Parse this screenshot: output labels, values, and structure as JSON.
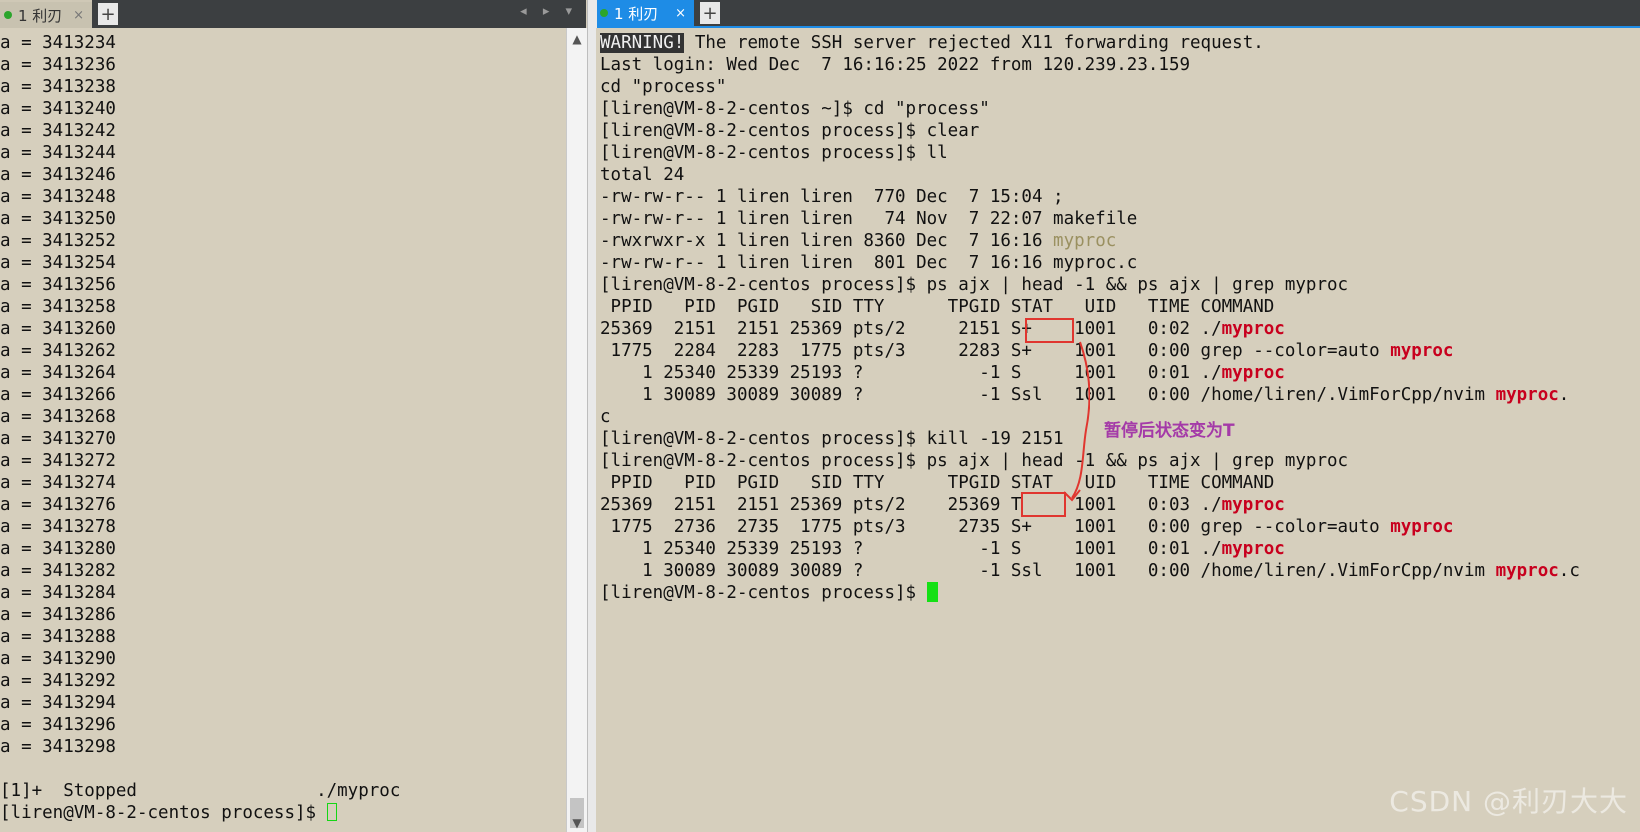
{
  "left_tab": {
    "label": "1 利刃",
    "close": "×",
    "add": "+",
    "nav": "◂ ▸ ▾"
  },
  "right_tab": {
    "label": "1 利刃",
    "close": "×",
    "add": "+"
  },
  "left_terminal": {
    "lines": [
      "a = 3413234",
      "a = 3413236",
      "a = 3413238",
      "a = 3413240",
      "a = 3413242",
      "a = 3413244",
      "a = 3413246",
      "a = 3413248",
      "a = 3413250",
      "a = 3413252",
      "a = 3413254",
      "a = 3413256",
      "a = 3413258",
      "a = 3413260",
      "a = 3413262",
      "a = 3413264",
      "a = 3413266",
      "a = 3413268",
      "a = 3413270",
      "a = 3413272",
      "a = 3413274",
      "a = 3413276",
      "a = 3413278",
      "a = 3413280",
      "a = 3413282",
      "a = 3413284",
      "a = 3413286",
      "a = 3413288",
      "a = 3413290",
      "a = 3413292",
      "a = 3413294",
      "a = 3413296",
      "a = 3413298"
    ],
    "stopped": "[1]+  Stopped                 ./myproc",
    "prompt": "[liren@VM-8-2-centos process]$ "
  },
  "right_terminal": {
    "warning_label": "WARNING!",
    "warning_text": " The remote SSH server rejected X11 forwarding request.",
    "lines_a": [
      "Last login: Wed Dec  7 16:16:25 2022 from 120.239.23.159",
      "cd \"process\"",
      "[liren@VM-8-2-centos ~]$ cd \"process\"",
      "[liren@VM-8-2-centos process]$ clear",
      "[liren@VM-8-2-centos process]$ ll",
      "total 24",
      "-rw-rw-r-- 1 liren liren  770 Dec  7 15:04 ;",
      "-rw-rw-r-- 1 liren liren   74 Nov  7 22:07 makefile"
    ],
    "ll_exe_prefix": "-rwxrwxr-x 1 liren liren 8360 Dec  7 16:16 ",
    "ll_exe_name": "myproc",
    "ll_c": "-rw-rw-r-- 1 liren liren  801 Dec  7 16:16 myproc.c",
    "ps_cmd": "[liren@VM-8-2-centos process]$ ps ajx | head -1 && ps ajx | grep myproc",
    "ps_header": " PPID   PID  PGID   SID TTY      TPGID STAT   UID   TIME COMMAND",
    "ps1": {
      "r1": "25369  2151  2151 25369 pts/2     2151 S+    1001   0:02 ./",
      "r2": " 1775  2284  2283  1775 pts/3     2283 S+    1001   0:00 grep --color=auto ",
      "r3": "    1 25340 25339 25193 ?           -1 S     1001   0:01 ./",
      "r4": "    1 30089 30089 30089 ?           -1 Ssl   1001   0:00 /home/liren/.VimForCpp/nvim ",
      "r4_tail": ".",
      "wrap": "c"
    },
    "kill_cmd": "[liren@VM-8-2-centos process]$ kill -19 2151",
    "ps2": {
      "r1": "25369  2151  2151 25369 pts/2    25369 T     1001   0:03 ./",
      "r2": " 1775  2736  2735  1775 pts/3     2735 S+    1001   0:00 grep --color=auto ",
      "r3": "    1 25340 25339 25193 ?           -1 S     1001   0:01 ./",
      "r4": "    1 30089 30089 30089 ?           -1 Ssl   1001   0:00 /home/liren/.VimForCpp/nvim ",
      "r4_tail": ".c"
    },
    "highlight": "myproc",
    "prompt": "[liren@VM-8-2-centos process]$ "
  },
  "annotation": "暂停后状态变为T",
  "watermark": "CSDN @利刃大大",
  "scroll": {
    "up": "▲",
    "down": "▼"
  },
  "colors": {
    "terminal_bg": "#d6cfbd",
    "active_tab": "#1e8ce6",
    "highlight_red": "#c8001e",
    "box_red": "#e0362f",
    "annotation_purple": "#a43aa8",
    "cursor_green": "#15e015"
  }
}
